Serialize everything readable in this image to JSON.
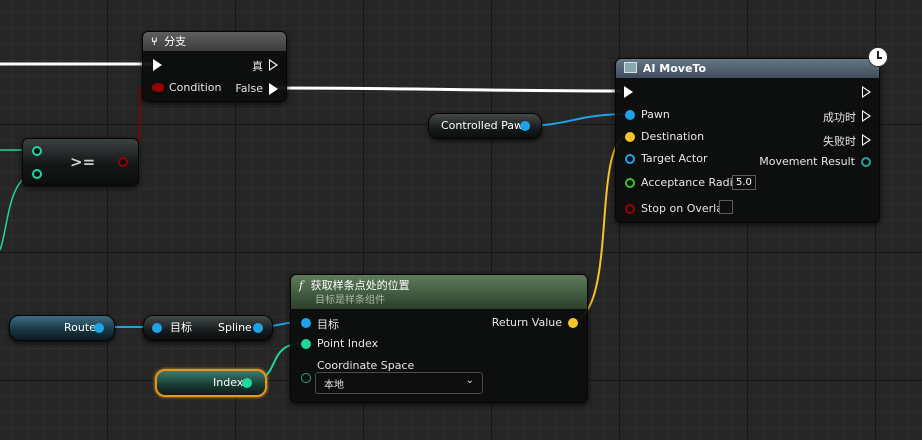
{
  "branch_node": {
    "title": "分支",
    "condition_label": "Condition",
    "true_label": "真",
    "false_label": "False"
  },
  "compare_node": {
    "operator": ">="
  },
  "moveto_node": {
    "title": "AI MoveTo",
    "pawn_label": "Pawn",
    "destination_label": "Destination",
    "target_actor_label": "Target Actor",
    "acceptance_radius_label": "Acceptance Radius",
    "acceptance_radius_value": "5.0",
    "stop_on_overlap_label": "Stop on Overlap",
    "success_label": "成功时",
    "fail_label": "失败时",
    "movement_result_label": "Movement Result"
  },
  "controlled_pawn_node": {
    "label": "Controlled Pawn"
  },
  "spline_node": {
    "title": "获取样条点处的位置",
    "subtitle": "目标是样条组件",
    "target_label": "目标",
    "point_index_label": "Point Index",
    "coordinate_space_label": "Coordinate Space",
    "coordinate_space_value": "本地",
    "return_value_label": "Return Value"
  },
  "route_node": {
    "label": "Route"
  },
  "get_spline_node": {
    "target_label": "目标",
    "spline_label": "Spline"
  },
  "index_node": {
    "label": "Index"
  },
  "colors": {
    "exec": "#ffffff",
    "object_pin": "#1fa3e8",
    "vector_pin": "#f5c427",
    "int_pin": "#1fd6a0",
    "bool_pin": "#9a0000",
    "float_pin": "#3ec232",
    "struct_pin": "#2aa190"
  }
}
